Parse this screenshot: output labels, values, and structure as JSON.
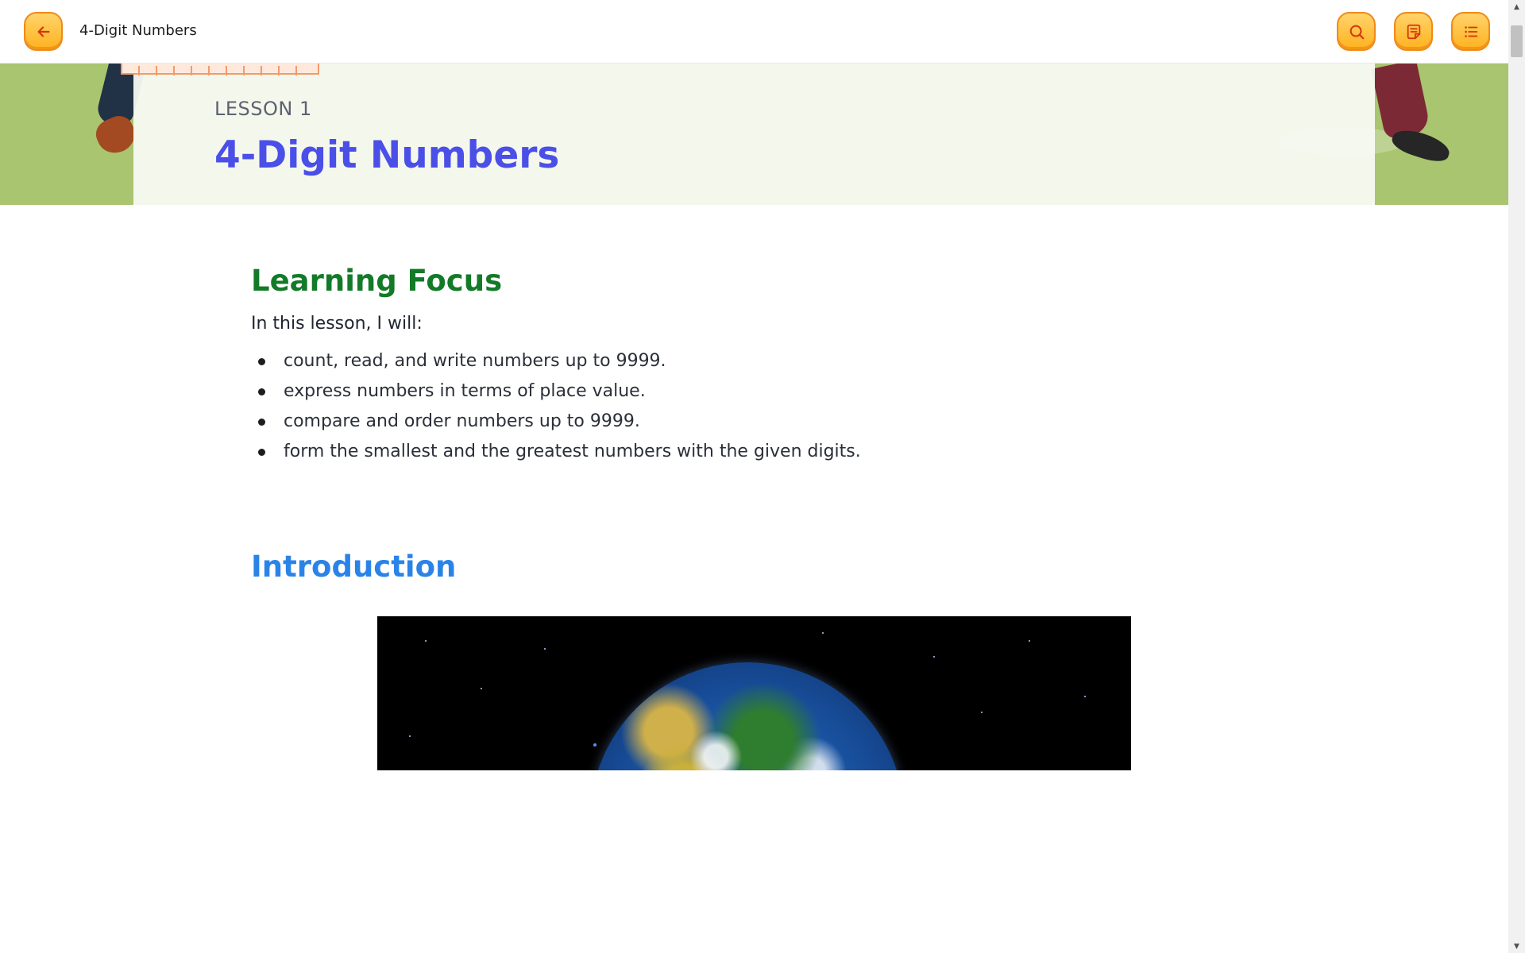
{
  "topbar": {
    "title": "4-Digit Numbers",
    "back_icon": "arrow-left-icon",
    "search_icon": "search-icon",
    "notes_icon": "notebook-icon",
    "toc_icon": "list-icon"
  },
  "banner": {
    "lesson_label": "LESSON 1",
    "lesson_title": "4-Digit Numbers"
  },
  "learning_focus": {
    "title": "Learning Focus",
    "lead": "In this lesson, I will:",
    "items": [
      "count, read, and write numbers up to 9999.",
      "express numbers in terms of place value.",
      "compare and order numbers up to 9999.",
      "form the smallest and the greatest numbers with the given digits."
    ]
  },
  "introduction": {
    "title": "Introduction",
    "image_icon": "earth-image"
  },
  "colors": {
    "accent_orange": "#ffb21f",
    "title_blue": "#4a4fe8",
    "focus_green": "#137a28",
    "intro_blue": "#2a84e8",
    "banner_green": "#a9c56f"
  }
}
